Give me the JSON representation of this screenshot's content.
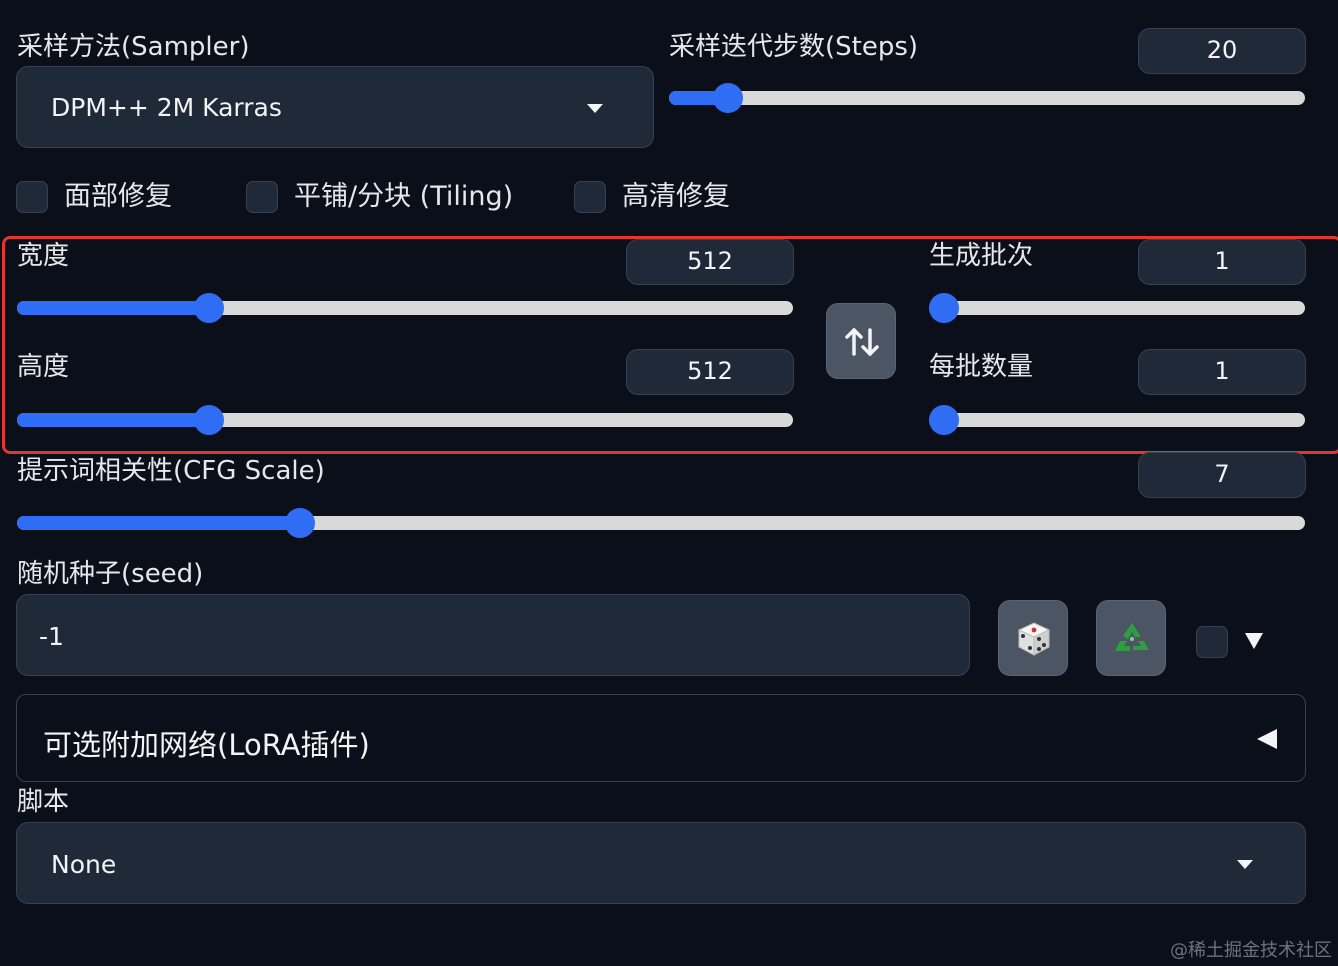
{
  "sampler": {
    "label": "采样方法(Sampler)",
    "value": "DPM++ 2M Karras"
  },
  "steps": {
    "label": "采样迭代步数(Steps)",
    "value": "20",
    "fraction": 0.072
  },
  "checkboxes": [
    {
      "label": "面部修复",
      "checked": false
    },
    {
      "label": "平铺/分块 (Tiling)",
      "checked": false
    },
    {
      "label": "高清修复",
      "checked": false
    }
  ],
  "width": {
    "label": "宽度",
    "value": "512",
    "fraction": 0.237
  },
  "height": {
    "label": "高度",
    "value": "512",
    "fraction": 0.237
  },
  "swap_icon": "swap-arrows-icon",
  "batch_count": {
    "label": "生成批次",
    "value": "1",
    "fraction": 0.0
  },
  "batch_size": {
    "label": "每批数量",
    "value": "1",
    "fraction": 0.0
  },
  "cfg": {
    "label": "提示词相关性(CFG Scale)",
    "value": "7",
    "fraction": 0.213
  },
  "seed": {
    "label": "随机种子(seed)",
    "value": "-1",
    "dice_icon": "dice-icon",
    "recycle_icon": "recycle-icon",
    "extra_checked": false,
    "expand_icon": "triangle-down-icon"
  },
  "lora": {
    "label": "可选附加网络(LoRA插件)",
    "toggle_icon": "triangle-left-icon"
  },
  "script": {
    "label": "脚本",
    "value": "None"
  },
  "watermark": "@稀土掘金技术社区",
  "colors": {
    "accent": "#2f6df5",
    "highlight_border": "#e0382c",
    "background": "#0b0f19",
    "panel": "#1f2937"
  }
}
